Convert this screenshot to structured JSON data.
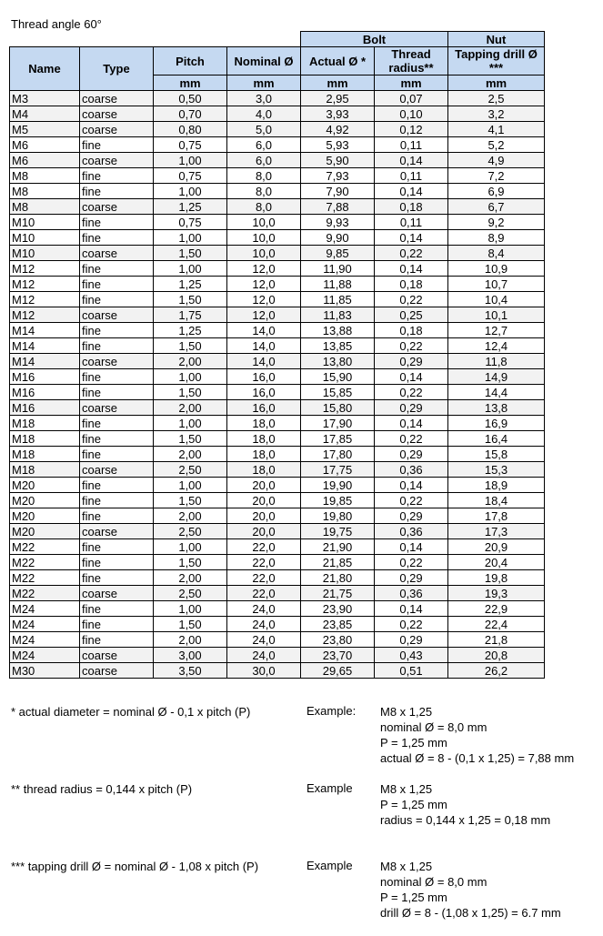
{
  "title": "Thread angle  60°",
  "table": {
    "group_headers": {
      "bolt": "Bolt",
      "nut": "Nut"
    },
    "columns": {
      "name": "Name",
      "type": "Type",
      "pitch": "Pitch",
      "nominal": "Nominal Ø",
      "actual": "Actual Ø *",
      "radius_line1": "Thread",
      "radius_line2": "radius**",
      "drill_line1": "Tapping drill Ø",
      "drill_line2": "***"
    },
    "unit": "mm",
    "rows": [
      {
        "name": "M3",
        "type": "coarse",
        "pitch": "0,50",
        "nominal": "3,0",
        "actual": "2,95",
        "radius": "0,07",
        "drill": "2,5"
      },
      {
        "name": "M4",
        "type": "coarse",
        "pitch": "0,70",
        "nominal": "4,0",
        "actual": "3,93",
        "radius": "0,10",
        "drill": "3,2"
      },
      {
        "name": "M5",
        "type": "coarse",
        "pitch": "0,80",
        "nominal": "5,0",
        "actual": "4,92",
        "radius": "0,12",
        "drill": "4,1"
      },
      {
        "name": "M6",
        "type": "fine",
        "pitch": "0,75",
        "nominal": "6,0",
        "actual": "5,93",
        "radius": "0,11",
        "drill": "5,2"
      },
      {
        "name": "M6",
        "type": "coarse",
        "pitch": "1,00",
        "nominal": "6,0",
        "actual": "5,90",
        "radius": "0,14",
        "drill": "4,9"
      },
      {
        "name": "M8",
        "type": "fine",
        "pitch": "0,75",
        "nominal": "8,0",
        "actual": "7,93",
        "radius": "0,11",
        "drill": "7,2"
      },
      {
        "name": "M8",
        "type": "fine",
        "pitch": "1,00",
        "nominal": "8,0",
        "actual": "7,90",
        "radius": "0,14",
        "drill": "6,9"
      },
      {
        "name": "M8",
        "type": "coarse",
        "pitch": "1,25",
        "nominal": "8,0",
        "actual": "7,88",
        "radius": "0,18",
        "drill": "6,7"
      },
      {
        "name": "M10",
        "type": "fine",
        "pitch": "0,75",
        "nominal": "10,0",
        "actual": "9,93",
        "radius": "0,11",
        "drill": "9,2"
      },
      {
        "name": "M10",
        "type": "fine",
        "pitch": "1,00",
        "nominal": "10,0",
        "actual": "9,90",
        "radius": "0,14",
        "drill": "8,9"
      },
      {
        "name": "M10",
        "type": "coarse",
        "pitch": "1,50",
        "nominal": "10,0",
        "actual": "9,85",
        "radius": "0,22",
        "drill": "8,4"
      },
      {
        "name": "M12",
        "type": "fine",
        "pitch": "1,00",
        "nominal": "12,0",
        "actual": "11,90",
        "radius": "0,14",
        "drill": "10,9"
      },
      {
        "name": "M12",
        "type": "fine",
        "pitch": "1,25",
        "nominal": "12,0",
        "actual": "11,88",
        "radius": "0,18",
        "drill": "10,7"
      },
      {
        "name": "M12",
        "type": "fine",
        "pitch": "1,50",
        "nominal": "12,0",
        "actual": "11,85",
        "radius": "0,22",
        "drill": "10,4"
      },
      {
        "name": "M12",
        "type": "coarse",
        "pitch": "1,75",
        "nominal": "12,0",
        "actual": "11,83",
        "radius": "0,25",
        "drill": "10,1"
      },
      {
        "name": "M14",
        "type": "fine",
        "pitch": "1,25",
        "nominal": "14,0",
        "actual": "13,88",
        "radius": "0,18",
        "drill": "12,7"
      },
      {
        "name": "M14",
        "type": "fine",
        "pitch": "1,50",
        "nominal": "14,0",
        "actual": "13,85",
        "radius": "0,22",
        "drill": "12,4"
      },
      {
        "name": "M14",
        "type": "coarse",
        "pitch": "2,00",
        "nominal": "14,0",
        "actual": "13,80",
        "radius": "0,29",
        "drill": "11,8"
      },
      {
        "name": "M16",
        "type": "fine",
        "pitch": "1,00",
        "nominal": "16,0",
        "actual": "15,90",
        "radius": "0,14",
        "drill": "14,9"
      },
      {
        "name": "M16",
        "type": "fine",
        "pitch": "1,50",
        "nominal": "16,0",
        "actual": "15,85",
        "radius": "0,22",
        "drill": "14,4"
      },
      {
        "name": "M16",
        "type": "coarse",
        "pitch": "2,00",
        "nominal": "16,0",
        "actual": "15,80",
        "radius": "0,29",
        "drill": "13,8"
      },
      {
        "name": "M18",
        "type": "fine",
        "pitch": "1,00",
        "nominal": "18,0",
        "actual": "17,90",
        "radius": "0,14",
        "drill": "16,9"
      },
      {
        "name": "M18",
        "type": "fine",
        "pitch": "1,50",
        "nominal": "18,0",
        "actual": "17,85",
        "radius": "0,22",
        "drill": "16,4"
      },
      {
        "name": "M18",
        "type": "fine",
        "pitch": "2,00",
        "nominal": "18,0",
        "actual": "17,80",
        "radius": "0,29",
        "drill": "15,8"
      },
      {
        "name": "M18",
        "type": "coarse",
        "pitch": "2,50",
        "nominal": "18,0",
        "actual": "17,75",
        "radius": "0,36",
        "drill": "15,3"
      },
      {
        "name": "M20",
        "type": "fine",
        "pitch": "1,00",
        "nominal": "20,0",
        "actual": "19,90",
        "radius": "0,14",
        "drill": "18,9"
      },
      {
        "name": "M20",
        "type": "fine",
        "pitch": "1,50",
        "nominal": "20,0",
        "actual": "19,85",
        "radius": "0,22",
        "drill": "18,4"
      },
      {
        "name": "M20",
        "type": "fine",
        "pitch": "2,00",
        "nominal": "20,0",
        "actual": "19,80",
        "radius": "0,29",
        "drill": "17,8"
      },
      {
        "name": "M20",
        "type": "coarse",
        "pitch": "2,50",
        "nominal": "20,0",
        "actual": "19,75",
        "radius": "0,36",
        "drill": "17,3"
      },
      {
        "name": "M22",
        "type": "fine",
        "pitch": "1,00",
        "nominal": "22,0",
        "actual": "21,90",
        "radius": "0,14",
        "drill": "20,9"
      },
      {
        "name": "M22",
        "type": "fine",
        "pitch": "1,50",
        "nominal": "22,0",
        "actual": "21,85",
        "radius": "0,22",
        "drill": "20,4"
      },
      {
        "name": "M22",
        "type": "fine",
        "pitch": "2,00",
        "nominal": "22,0",
        "actual": "21,80",
        "radius": "0,29",
        "drill": "19,8"
      },
      {
        "name": "M22",
        "type": "coarse",
        "pitch": "2,50",
        "nominal": "22,0",
        "actual": "21,75",
        "radius": "0,36",
        "drill": "19,3"
      },
      {
        "name": "M24",
        "type": "fine",
        "pitch": "1,00",
        "nominal": "24,0",
        "actual": "23,90",
        "radius": "0,14",
        "drill": "22,9"
      },
      {
        "name": "M24",
        "type": "fine",
        "pitch": "1,50",
        "nominal": "24,0",
        "actual": "23,85",
        "radius": "0,22",
        "drill": "22,4"
      },
      {
        "name": "M24",
        "type": "fine",
        "pitch": "2,00",
        "nominal": "24,0",
        "actual": "23,80",
        "radius": "0,29",
        "drill": "21,8"
      },
      {
        "name": "M24",
        "type": "coarse",
        "pitch": "3,00",
        "nominal": "24,0",
        "actual": "23,70",
        "radius": "0,43",
        "drill": "20,8"
      },
      {
        "name": "M30",
        "type": "coarse",
        "pitch": "3,50",
        "nominal": "30,0",
        "actual": "29,65",
        "radius": "0,51",
        "drill": "26,2"
      }
    ]
  },
  "colors": {
    "header_bg": "#c5d9f1",
    "coarse_row_bg": "#f2f2f2",
    "border": "#000000"
  },
  "notes": [
    {
      "formula": "* actual diameter = nominal Ø  - 0,1 x pitch (P)",
      "example_label": "Example:",
      "example_lines": [
        "M8 x 1,25",
        "nominal Ø = 8,0 mm",
        "P = 1,25 mm",
        "actual Ø = 8 - (0,1 x 1,25) = 7,88 mm"
      ]
    },
    {
      "formula": "** thread radius = 0,144 x pitch (P)",
      "example_label": "Example",
      "example_lines": [
        "M8 x 1,25",
        "P = 1,25 mm",
        "radius = 0,144 x 1,25 = 0,18 mm"
      ]
    },
    {
      "formula": "*** tapping drill Ø = nominal Ø - 1,08 x pitch (P)",
      "example_label": "Example",
      "example_lines": [
        "M8 x 1,25",
        "nominal Ø = 8,0 mm",
        "P = 1,25 mm",
        "drill Ø = 8 - (1,08 x 1,25) = 6.7 mm"
      ]
    }
  ]
}
